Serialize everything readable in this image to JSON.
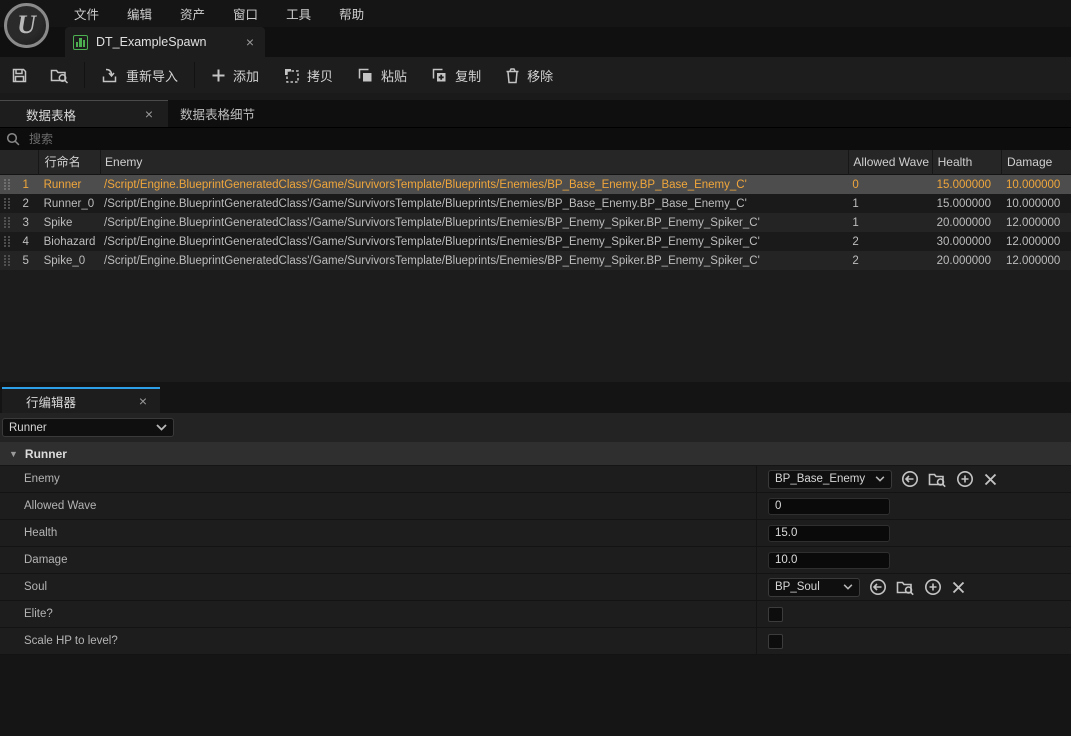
{
  "window": {
    "menu": [
      {
        "label": "文件"
      },
      {
        "label": "编辑"
      },
      {
        "label": "资产"
      },
      {
        "label": "窗口"
      },
      {
        "label": "工具"
      },
      {
        "label": "帮助"
      }
    ],
    "asset_tab": {
      "title": "DT_ExampleSpawn"
    }
  },
  "glyphs": {
    "close": "×",
    "tri_down": "▼"
  },
  "toolbar": {
    "reimport": "重新导入",
    "add": "添加",
    "copy": "拷贝",
    "paste": "粘贴",
    "duplicate": "复制",
    "remove": "移除"
  },
  "panel_tabs": {
    "data_table": "数据表格",
    "data_table_details": "数据表格细节"
  },
  "search": {
    "placeholder": "搜索"
  },
  "table": {
    "columns": {
      "row_name": "行命名",
      "enemy": "Enemy",
      "allowed_wave": "Allowed Wave",
      "health": "Health",
      "damage": "Damage"
    },
    "rows": [
      {
        "num": "1",
        "name": "Runner",
        "path": "/Script/Engine.BlueprintGeneratedClass'/Game/SurvivorsTemplate/Blueprints/Enemies/BP_Base_Enemy.BP_Base_Enemy_C'",
        "wave": "0",
        "health": "15.000000",
        "damage": "10.000000",
        "selected": true
      },
      {
        "num": "2",
        "name": "Runner_0",
        "path": "/Script/Engine.BlueprintGeneratedClass'/Game/SurvivorsTemplate/Blueprints/Enemies/BP_Base_Enemy.BP_Base_Enemy_C'",
        "wave": "1",
        "health": "15.000000",
        "damage": "10.000000",
        "selected": false
      },
      {
        "num": "3",
        "name": "Spike",
        "path": "/Script/Engine.BlueprintGeneratedClass'/Game/SurvivorsTemplate/Blueprints/Enemies/BP_Enemy_Spiker.BP_Enemy_Spiker_C'",
        "wave": "1",
        "health": "20.000000",
        "damage": "12.000000",
        "selected": false
      },
      {
        "num": "4",
        "name": "Biohazard",
        "path": "/Script/Engine.BlueprintGeneratedClass'/Game/SurvivorsTemplate/Blueprints/Enemies/BP_Enemy_Spiker.BP_Enemy_Spiker_C'",
        "wave": "2",
        "health": "30.000000",
        "damage": "12.000000",
        "selected": false
      },
      {
        "num": "5",
        "name": "Spike_0",
        "path": "/Script/Engine.BlueprintGeneratedClass'/Game/SurvivorsTemplate/Blueprints/Enemies/BP_Enemy_Spiker.BP_Enemy_Spiker_C'",
        "wave": "2",
        "health": "20.000000",
        "damage": "12.000000",
        "selected": false
      }
    ]
  },
  "row_editor": {
    "tab": "行编辑器",
    "row_selector": {
      "value": "Runner"
    },
    "category": "Runner",
    "properties": [
      {
        "label": "Enemy",
        "value": "BP_Base_Enemy",
        "type": "asset-combo"
      },
      {
        "label": "Allowed Wave",
        "value": "0",
        "type": "text"
      },
      {
        "label": "Health",
        "value": "15.0",
        "type": "text"
      },
      {
        "label": "Damage",
        "value": "10.0",
        "type": "text"
      },
      {
        "label": "Soul",
        "value": "BP_Soul",
        "type": "asset-combo"
      },
      {
        "label": "Elite?",
        "checked": false,
        "type": "checkbox"
      },
      {
        "label": "Scale HP to level?",
        "checked": false,
        "type": "checkbox"
      }
    ]
  },
  "colors": {
    "accent_blue": "#2D9FE8",
    "selection_orange": "#F0A63B",
    "selected_row_bg": "#4D4D4D",
    "asset_icon_green": "#4CAF50",
    "background": "#151515"
  }
}
